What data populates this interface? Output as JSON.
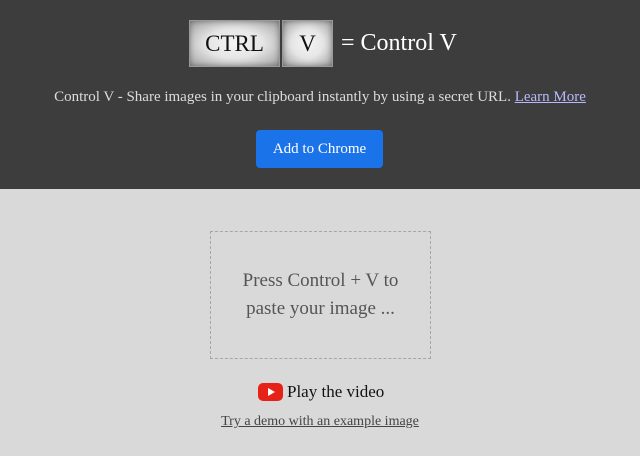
{
  "header": {
    "key_ctrl": "CTRL",
    "key_v": "V",
    "equals_text": "= Control V",
    "tagline": "Control V - Share images in your clipboard instantly by using a secret URL.",
    "learn_more": "Learn More",
    "add_button": "Add to Chrome"
  },
  "main": {
    "dropzone_text": "Press Control + V to paste your image ...",
    "video_label": "Play the video",
    "demo_link": "Try a demo with an example image"
  },
  "colors": {
    "header_bg": "#3d3d3d",
    "page_bg": "#d9d9d9",
    "button_bg": "#1a73e8",
    "link": "#b8b8ff",
    "youtube_red": "#e62117"
  },
  "icons": {
    "video": "youtube-play-icon"
  }
}
